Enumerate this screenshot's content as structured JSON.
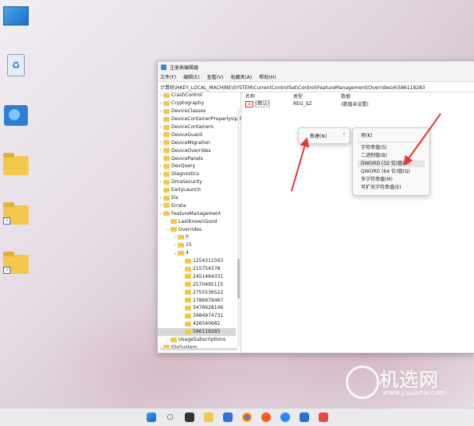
{
  "window": {
    "title": "注册表编辑器",
    "menu": [
      "文件(F)",
      "编辑(E)",
      "查看(V)",
      "收藏夹(A)",
      "帮助(H)"
    ],
    "address": "计算机\\HKEY_LOCAL_MACHINE\\SYSTEM\\CurrentControlSet\\Control\\FeatureManagement\\Overrides\\4\\586118283"
  },
  "tree": [
    {
      "label": "CrashControl",
      "indent": 0,
      "chev": ">"
    },
    {
      "label": "Cryptography",
      "indent": 0,
      "chev": ">"
    },
    {
      "label": "DeviceClasses",
      "indent": 0,
      "chev": ">"
    },
    {
      "label": "DeviceContainerPropertyUpda",
      "indent": 0,
      "chev": ""
    },
    {
      "label": "DeviceContainers",
      "indent": 0,
      "chev": ">"
    },
    {
      "label": "DeviceGuard",
      "indent": 0,
      "chev": ">"
    },
    {
      "label": "DeviceMigration",
      "indent": 0,
      "chev": ">"
    },
    {
      "label": "DeviceOverrides",
      "indent": 0,
      "chev": ">"
    },
    {
      "label": "DevicePanels",
      "indent": 0,
      "chev": ""
    },
    {
      "label": "DevQuery",
      "indent": 0,
      "chev": ">"
    },
    {
      "label": "Diagnostics",
      "indent": 0,
      "chev": ">"
    },
    {
      "label": "DmaSecurity",
      "indent": 0,
      "chev": ">"
    },
    {
      "label": "EarlyLaunch",
      "indent": 0,
      "chev": ""
    },
    {
      "label": "Els",
      "indent": 0,
      "chev": ">"
    },
    {
      "label": "Errata",
      "indent": 0,
      "chev": ">"
    },
    {
      "label": "FeatureManagement",
      "indent": 0,
      "chev": "v"
    },
    {
      "label": "LastKnownGood",
      "indent": 1,
      "chev": ""
    },
    {
      "label": "Overrides",
      "indent": 1,
      "chev": "v"
    },
    {
      "label": "0",
      "indent": 2,
      "chev": ">"
    },
    {
      "label": "15",
      "indent": 2,
      "chev": ">"
    },
    {
      "label": "4",
      "indent": 2,
      "chev": "v"
    },
    {
      "label": "1254311563",
      "indent": 3,
      "chev": ""
    },
    {
      "label": "215754378",
      "indent": 3,
      "chev": ""
    },
    {
      "label": "2451464331",
      "indent": 3,
      "chev": ""
    },
    {
      "label": "2570495115",
      "indent": 3,
      "chev": ""
    },
    {
      "label": "2755536522",
      "indent": 3,
      "chev": ""
    },
    {
      "label": "2786979467",
      "indent": 3,
      "chev": ""
    },
    {
      "label": "3476628106",
      "indent": 3,
      "chev": ""
    },
    {
      "label": "3484974731",
      "indent": 3,
      "chev": ""
    },
    {
      "label": "426540682",
      "indent": 3,
      "chev": ""
    },
    {
      "label": "586118283",
      "indent": 3,
      "chev": "",
      "selected": true
    },
    {
      "label": "UsageSubscriptions",
      "indent": 1,
      "chev": ">"
    },
    {
      "label": "FileSystem",
      "indent": 0,
      "chev": ">"
    }
  ],
  "values": {
    "headers": {
      "name": "名称",
      "type": "类型",
      "data": "数据"
    },
    "rows": [
      {
        "name": "(默认)",
        "type": "REG_SZ",
        "data": "(数值未设置)"
      }
    ]
  },
  "context_menu": {
    "new_label": "新建(N)",
    "arrow": "›",
    "submenu": [
      "项(K)",
      "字符串值(S)",
      "二进制值(B)",
      "DWORD (32 位)值(D)",
      "QWORD (64 位)值(Q)",
      "多字符串值(M)",
      "可扩充字符串值(E)"
    ]
  },
  "watermark": {
    "text": "机选网",
    "url": "www.jixuanw.com"
  },
  "colors": {
    "annotation_arrow": "#e53935",
    "folder": "#f2c94c",
    "accent": "#1a5fb4"
  }
}
